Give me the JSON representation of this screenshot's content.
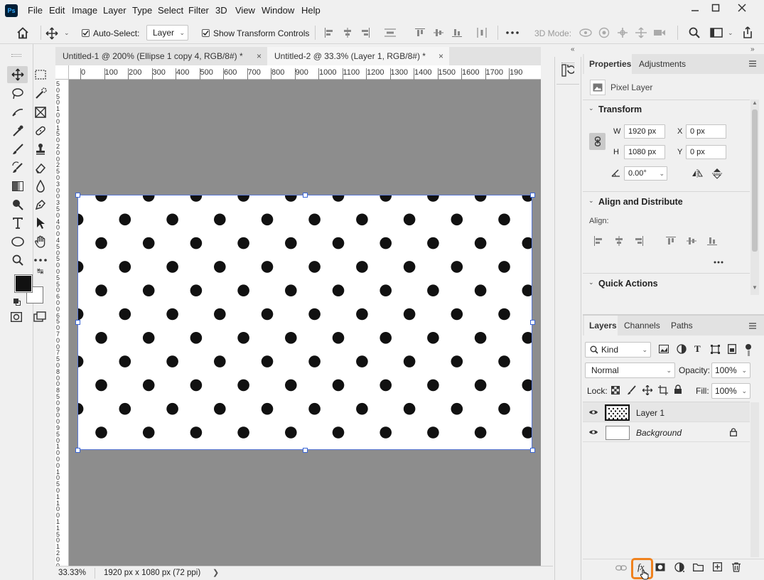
{
  "app": {
    "logo": "Ps"
  },
  "menu": [
    "File",
    "Edit",
    "Image",
    "Layer",
    "Type",
    "Select",
    "Filter",
    "3D",
    "View",
    "Window",
    "Help"
  ],
  "window_controls": {
    "minimize": "minimize-icon",
    "maximize": "maximize-icon",
    "close": "close-icon"
  },
  "options_bar": {
    "auto_select_label": "Auto-Select:",
    "auto_select_checked": true,
    "auto_select_target": "Layer",
    "transform_controls_label": "Show Transform Controls",
    "transform_controls_checked": true,
    "three_d_mode_label": "3D Mode:"
  },
  "tabs": [
    {
      "label": "Untitled-1 @ 200% (Ellipse 1 copy 4, RGB/8#) *",
      "active": false
    },
    {
      "label": "Untitled-2 @ 33.3% (Layer 1, RGB/8#) *",
      "active": true
    }
  ],
  "ruler": {
    "h_ticks": [
      "0",
      "100",
      "200",
      "300",
      "400",
      "500",
      "600",
      "700",
      "800",
      "900",
      "1000",
      "1100",
      "1200",
      "1300",
      "1400",
      "1500",
      "1600",
      "1700",
      "190"
    ],
    "v_ticks": [
      "5",
      "0",
      "5",
      "0",
      "1",
      "0",
      "0",
      "1",
      "5",
      "0",
      "2",
      "0",
      "0",
      "2",
      "5",
      "0",
      "3",
      "0",
      "0",
      "3",
      "5",
      "0",
      "4",
      "0",
      "0",
      "4",
      "5",
      "0",
      "5",
      "0",
      "0",
      "5",
      "5",
      "0",
      "6",
      "0",
      "0",
      "6",
      "5",
      "0",
      "7",
      "0",
      "0",
      "7",
      "5",
      "0",
      "8",
      "0",
      "0",
      "8",
      "5",
      "0",
      "9",
      "0",
      "0",
      "9",
      "5",
      "0",
      "1",
      "0",
      "0",
      "0",
      "1",
      "0",
      "5",
      "0",
      "1",
      "1",
      "0",
      "0",
      "1",
      "1",
      "5",
      "0",
      "1",
      "2",
      "0",
      "0"
    ]
  },
  "status": {
    "zoom": "33.33%",
    "doc_info": "1920 px x 1080 px (72 ppi)"
  },
  "colors": {
    "foreground": "#111111",
    "background": "#ffffff",
    "accent_highlight": "#f0821e",
    "selection": "#3a66d6"
  },
  "properties_panel": {
    "tabs": [
      "Properties",
      "Adjustments"
    ],
    "kind": "Pixel Layer",
    "transform_title": "Transform",
    "w_label": "W",
    "w_value": "1920 px",
    "h_label": "H",
    "h_value": "1080 px",
    "x_label": "X",
    "x_value": "0 px",
    "y_label": "Y",
    "y_value": "0 px",
    "angle_value": "0.00°",
    "align_title": "Align and Distribute",
    "align_label": "Align:",
    "quick_actions_title": "Quick Actions"
  },
  "layers_panel": {
    "tabs": [
      "Layers",
      "Channels",
      "Paths"
    ],
    "filter_kind": "Kind",
    "blend_mode": "Normal",
    "opacity_label": "Opacity:",
    "opacity_value": "100%",
    "lock_label": "Lock:",
    "fill_label": "Fill:",
    "fill_value": "100%",
    "layers": [
      {
        "name": "Layer 1",
        "selected": true,
        "visible": true,
        "locked": false
      },
      {
        "name": "Background",
        "selected": false,
        "visible": true,
        "locked": true
      }
    ]
  }
}
